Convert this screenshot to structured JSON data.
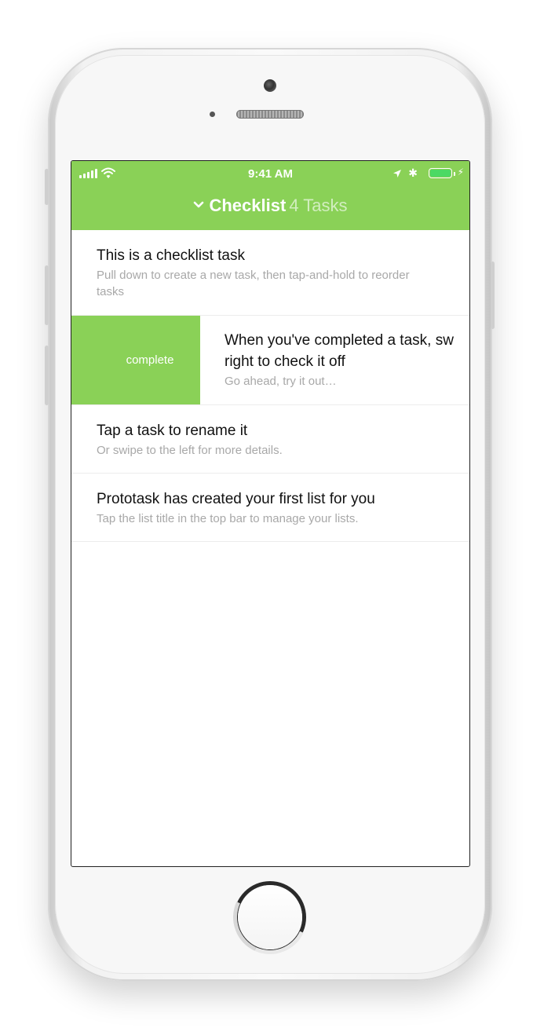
{
  "status_bar": {
    "time": "9:41 AM",
    "icons": [
      "signal-bars-icon",
      "wifi-icon",
      "location-arrow-icon",
      "bluetooth-icon",
      "battery-icon",
      "charging-bolt-icon"
    ]
  },
  "header": {
    "title": "Checklist",
    "count": "4 Tasks",
    "accent_color": "#8ad157"
  },
  "tasks": [
    {
      "title": "This is a checklist task",
      "subtitle": "Pull down to create a new task, then tap-and-hold to reorder tasks"
    },
    {
      "title": "When you've completed a task, sw",
      "title_line2": "right to check it off",
      "subtitle": "Go ahead, try it out…",
      "swipe_action": "complete"
    },
    {
      "title": "Tap a task to rename it",
      "subtitle": "Or swipe to the left for more details."
    },
    {
      "title": "Prototask has created your first list for you",
      "subtitle": "Tap the list title in the top bar to manage your lists."
    }
  ]
}
